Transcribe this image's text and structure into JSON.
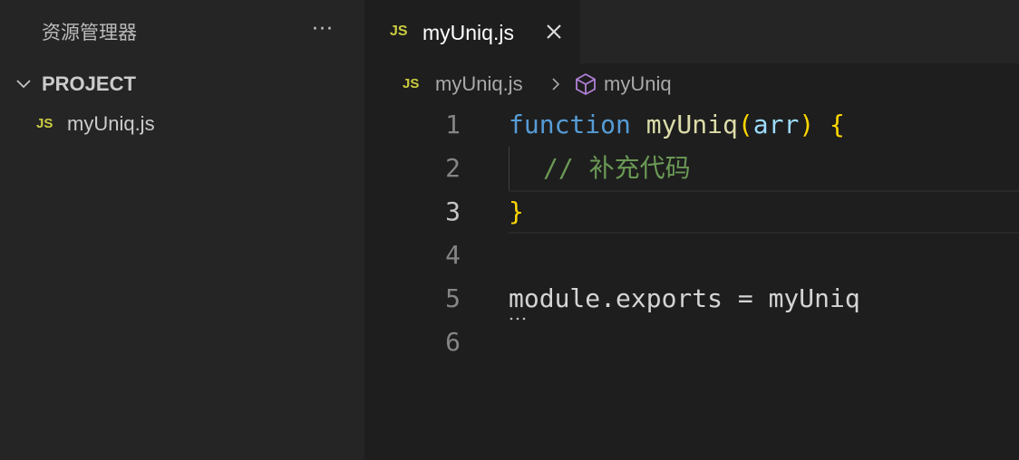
{
  "sidebar": {
    "title": "资源管理器",
    "more_label": "···",
    "section_title": "PROJECT",
    "files": [
      {
        "badge": "JS",
        "name": "myUniq.js"
      }
    ]
  },
  "editor": {
    "tab": {
      "badge": "JS",
      "label": "myUniq.js"
    },
    "breadcrumb": {
      "badge": "JS",
      "file": "myUniq.js",
      "symbol": "myUniq"
    },
    "active_line": 3,
    "lines": [
      {
        "number": "1",
        "tokens": {
          "keyword": "function",
          "name": "myUniq",
          "open_paren": "(",
          "param": "arr",
          "close_paren": ")",
          "open_brace": "{"
        }
      },
      {
        "number": "2",
        "text": "// 补充代码"
      },
      {
        "number": "3",
        "text": "}"
      },
      {
        "number": "4",
        "text": ""
      },
      {
        "number": "5",
        "text": "module.exports = myUniq"
      },
      {
        "number": "6",
        "text": ""
      }
    ]
  },
  "colors": {
    "sidebar_bg": "#252526",
    "editor_bg": "#1e1e1e",
    "js_badge": "#cbcb41",
    "keyword": "#569cd6",
    "function_name": "#dcdcaa",
    "parameter": "#9cdcfe",
    "bracket_level1": "#ffd700",
    "bracket_level2": "#da70d6",
    "comment": "#6a9955",
    "symbol_icon": "#b180d7"
  },
  "icons": {
    "more": "ellipsis-icon",
    "section_toggle": "chevron-down-icon",
    "tab_close": "close-icon",
    "breadcrumb_separator": "chevron-right-icon",
    "symbol": "cube-icon"
  }
}
